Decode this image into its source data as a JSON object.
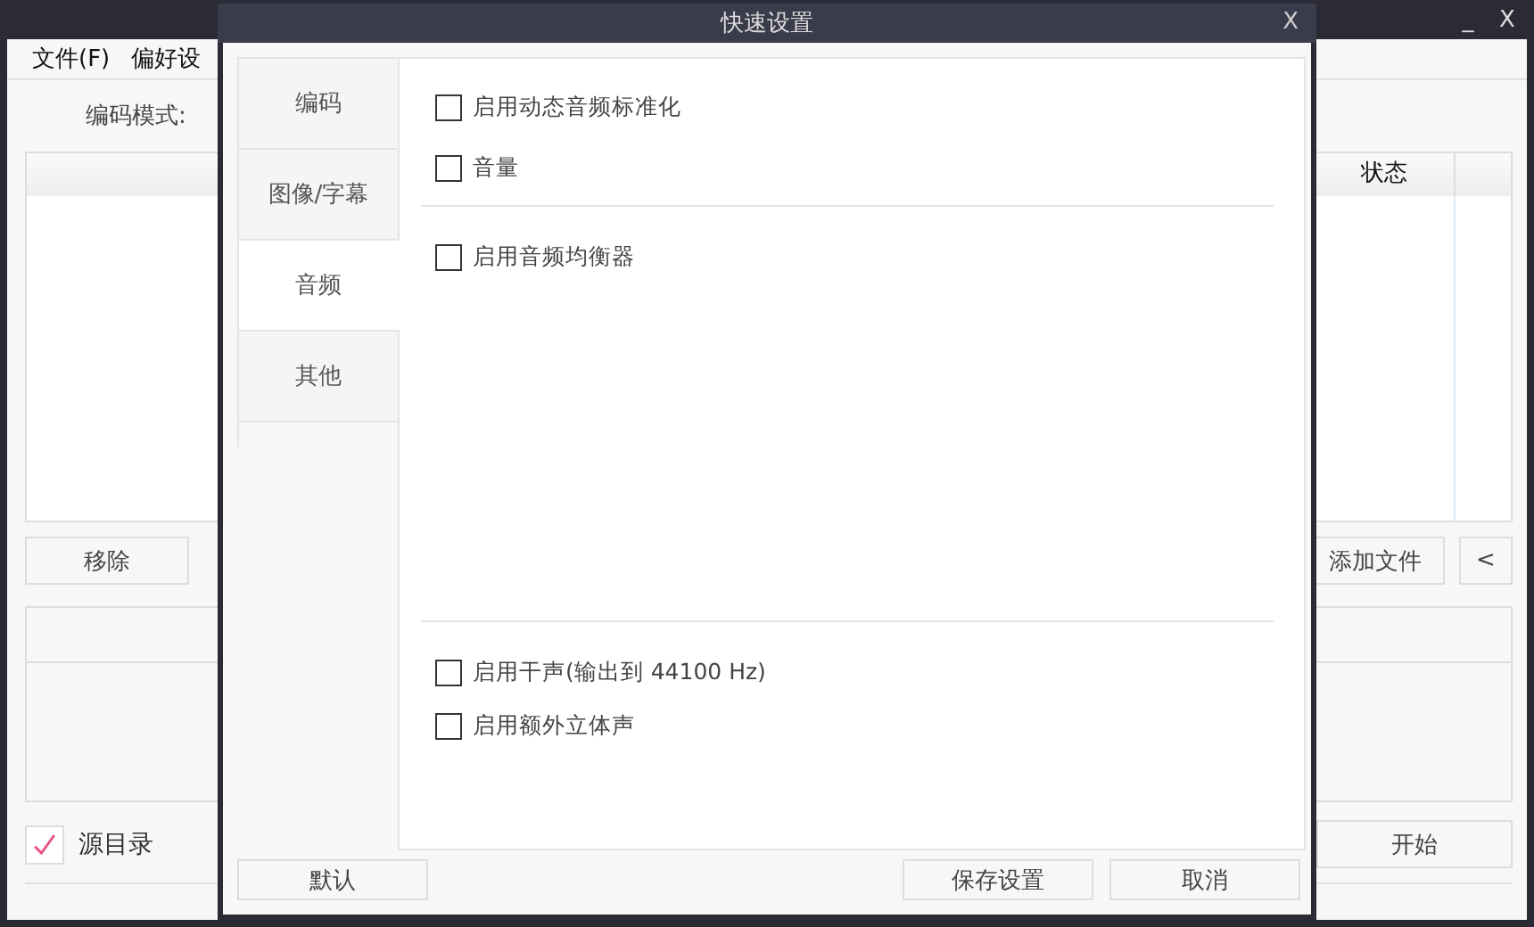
{
  "main_window": {
    "window_buttons": [
      "_",
      "X"
    ],
    "menu": [
      "文件(F)",
      "偏好设"
    ],
    "encoding_mode_label": "编码模式:",
    "table": {
      "columns": [
        {
          "label": "状态"
        }
      ]
    },
    "file_buttons": {
      "left": [
        "移除"
      ],
      "right": [
        "添加文件",
        "<"
      ]
    },
    "source_folder": {
      "label": "源目录",
      "checked": true
    },
    "start_button": "开始"
  },
  "dialog": {
    "title": "快速设置",
    "close": "X",
    "tabs": [
      {
        "label": "编码",
        "selected": false
      },
      {
        "label": "图像/字幕",
        "selected": false
      },
      {
        "label": "音频",
        "selected": true
      },
      {
        "label": "其他",
        "selected": false
      }
    ],
    "sections": [
      [
        {
          "label": "启用动态音频标准化",
          "checked": false
        },
        {
          "label": "音量",
          "checked": false
        }
      ],
      [
        {
          "label": "启用音频均衡器",
          "checked": false
        }
      ],
      [
        {
          "label": "启用干声(输出到 44100 Hz)",
          "checked": false
        },
        {
          "label": "启用额外立体声",
          "checked": false
        }
      ]
    ],
    "buttons": [
      "默认",
      "保存设置",
      "取消"
    ]
  }
}
